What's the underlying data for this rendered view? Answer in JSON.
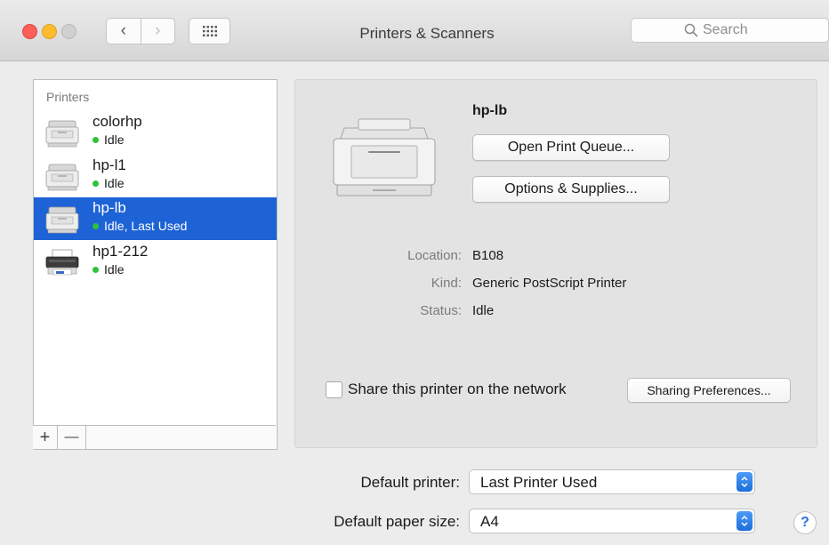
{
  "window": {
    "title": "Printers & Scanners",
    "search_placeholder": "Search",
    "back_glyph": "‹",
    "forward_glyph": "›"
  },
  "printers_panel": {
    "header": "Printers",
    "items": [
      {
        "name": "colorhp",
        "status": "Idle",
        "icon": "laser-printer-icon"
      },
      {
        "name": "hp-l1",
        "status": "Idle",
        "icon": "laser-printer-icon"
      },
      {
        "name": "hp-lb",
        "status": "Idle, Last Used",
        "icon": "laser-printer-icon",
        "selected": true
      },
      {
        "name": "hp1-212",
        "status": "Idle",
        "icon": "inkjet-printer-icon"
      }
    ],
    "add_label": "+",
    "remove_label": "—"
  },
  "details": {
    "name": "hp-lb",
    "open_queue_label": "Open Print Queue...",
    "options_label": "Options & Supplies...",
    "location_label": "Location:",
    "location_value": "B108",
    "kind_label": "Kind:",
    "kind_value": "Generic PostScript Printer",
    "status_label": "Status:",
    "status_value": "Idle",
    "share_label": "Share this printer on the network",
    "share_checked": false,
    "sharing_prefs_label": "Sharing Preferences..."
  },
  "defaults": {
    "printer_label": "Default printer:",
    "printer_value": "Last Printer Used",
    "paper_label": "Default paper size:",
    "paper_value": "A4"
  },
  "help_label": "?",
  "colors": {
    "selection": "#1d63d6",
    "status_dot": "#2cc23a",
    "popup_arrow": "#1c6fdb"
  }
}
